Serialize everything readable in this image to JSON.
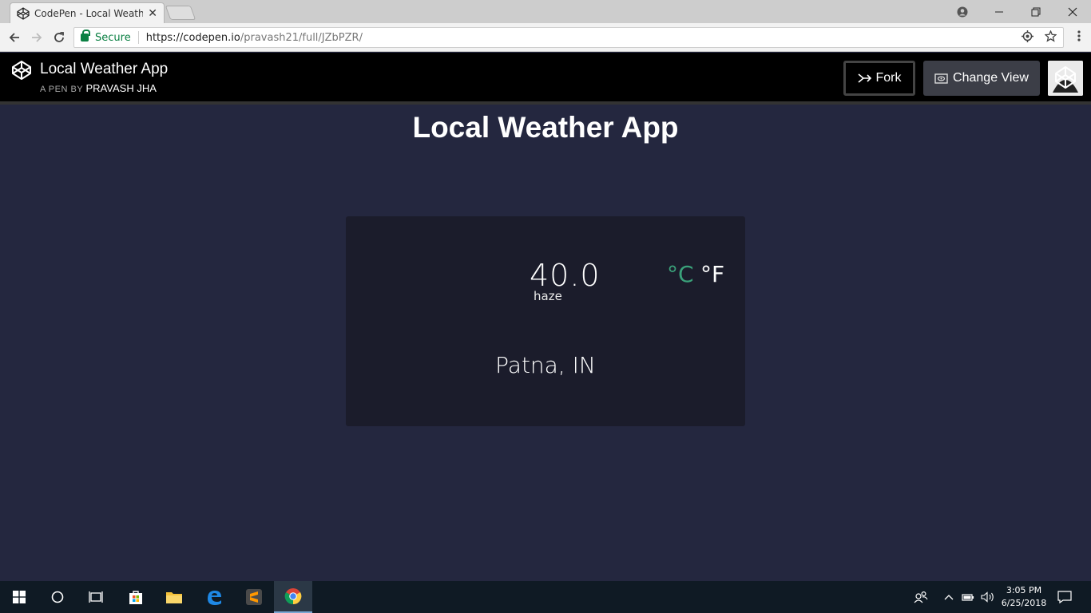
{
  "browser": {
    "tab_title": "CodePen - Local Weather",
    "tab_close": "✕",
    "secure_label": "Secure",
    "url_host": "https://codepen.io",
    "url_path": "/pravash21/full/JZbPZR/"
  },
  "codepen": {
    "title": "Local Weather App",
    "byline_prefix": "A PEN BY",
    "author": "PRAVASH JHA",
    "fork_label": "Fork",
    "change_view_label": "Change View"
  },
  "app": {
    "heading": "Local Weather App",
    "temperature": "40.0",
    "description": "haze",
    "unit_celsius": "°C",
    "unit_fahrenheit": "°F",
    "location": "Patna, IN"
  },
  "taskbar": {
    "time": "3:05 PM",
    "date": "6/25/2018"
  },
  "colors": {
    "page_background": "#24273f",
    "card_background": "#1b1c2b",
    "celsius_active": "#3aa17a"
  }
}
